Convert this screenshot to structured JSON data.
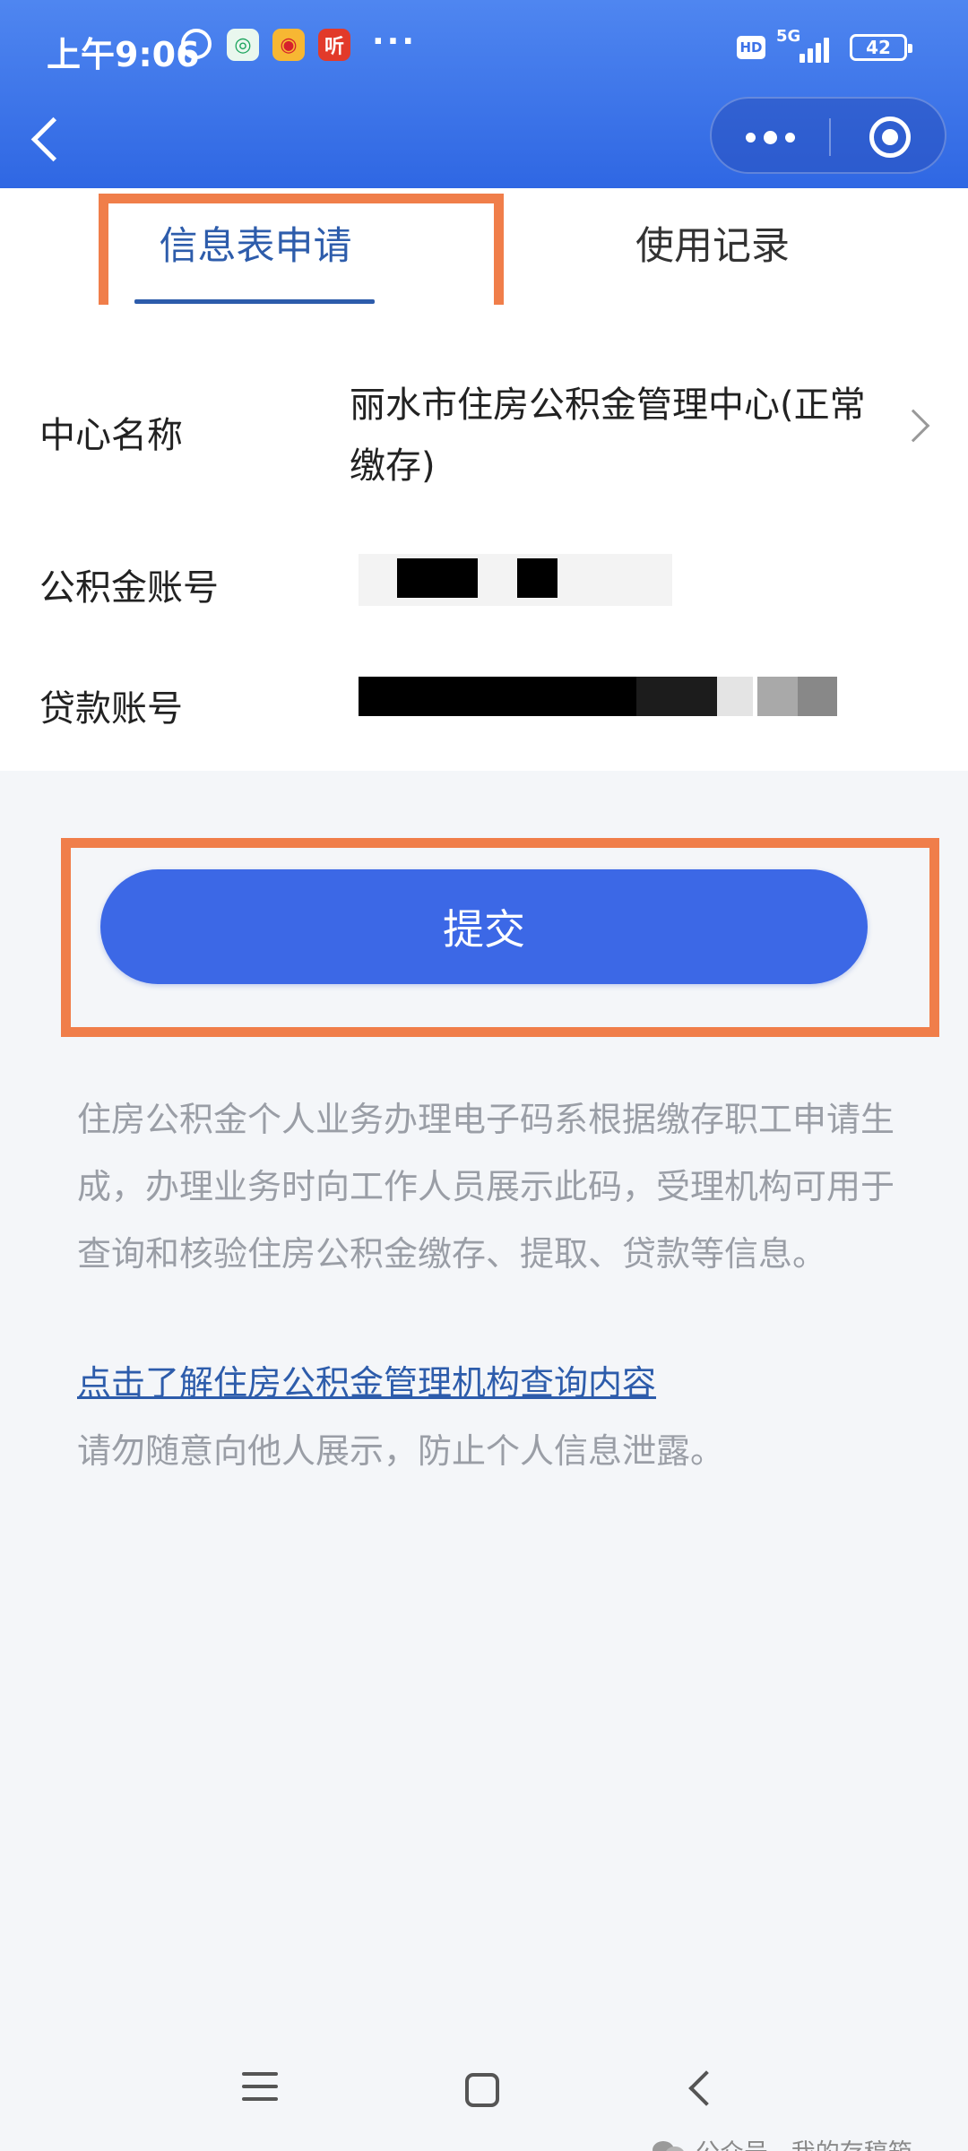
{
  "status_bar": {
    "time": "上午9:06",
    "listen_icon_char": "听",
    "more_dots": "···",
    "hd": "HD",
    "network": "5G",
    "battery": "42"
  },
  "tabs": [
    {
      "label": "信息表申请",
      "active": true
    },
    {
      "label": "使用记录",
      "active": false
    }
  ],
  "form": {
    "center_label": "中心名称",
    "center_value": "丽水市住房公积金管理中心(正常缴存)",
    "fund_account_label": "公积金账号",
    "loan_account_label": "贷款账号"
  },
  "submit_label": "提交",
  "notice": {
    "text": "住房公积金个人业务办理电子码系根据缴存职工申请生成，办理业务时向工作人员展示此码，受理机构可用于查询和核验住房公积金缴存、提取、贷款等信息。",
    "link": "点击了解住房公积金管理机构查询内容",
    "warning": "请勿随意向他人展示，防止个人信息泄露。"
  },
  "watermark": "公众号 · 我的存稿箱",
  "colors": {
    "header": "#3d72e8",
    "tab_active": "#2d5cab",
    "submit": "#3c68e6",
    "highlight": "#f07e4a"
  }
}
